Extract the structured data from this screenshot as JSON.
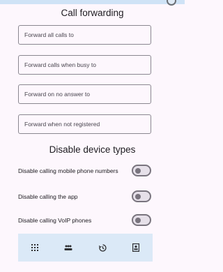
{
  "header": {
    "call_forwarding_title": "Call forwarding"
  },
  "forwarding_fields": [
    {
      "placeholder": "Forward all calls to",
      "value": ""
    },
    {
      "placeholder": "Forward calls when busy to",
      "value": ""
    },
    {
      "placeholder": "Forward on no answer to",
      "value": ""
    },
    {
      "placeholder": "Forward when not registered",
      "value": ""
    }
  ],
  "disable_section": {
    "title": "Disable device types",
    "toggles": [
      {
        "label": "Disable calling mobile phone numbers",
        "on": false
      },
      {
        "label": "Disable calling the app",
        "on": false
      },
      {
        "label": "Disable calling VoIP phones",
        "on": false
      }
    ]
  },
  "bottom_nav": {
    "items": [
      {
        "icon": "dialpad-icon"
      },
      {
        "icon": "people-icon"
      },
      {
        "icon": "history-icon"
      },
      {
        "icon": "contacts-icon"
      }
    ]
  },
  "colors": {
    "background": "#fdf7fd",
    "nav_background": "#dbe9f7",
    "outline": "#79747e"
  }
}
